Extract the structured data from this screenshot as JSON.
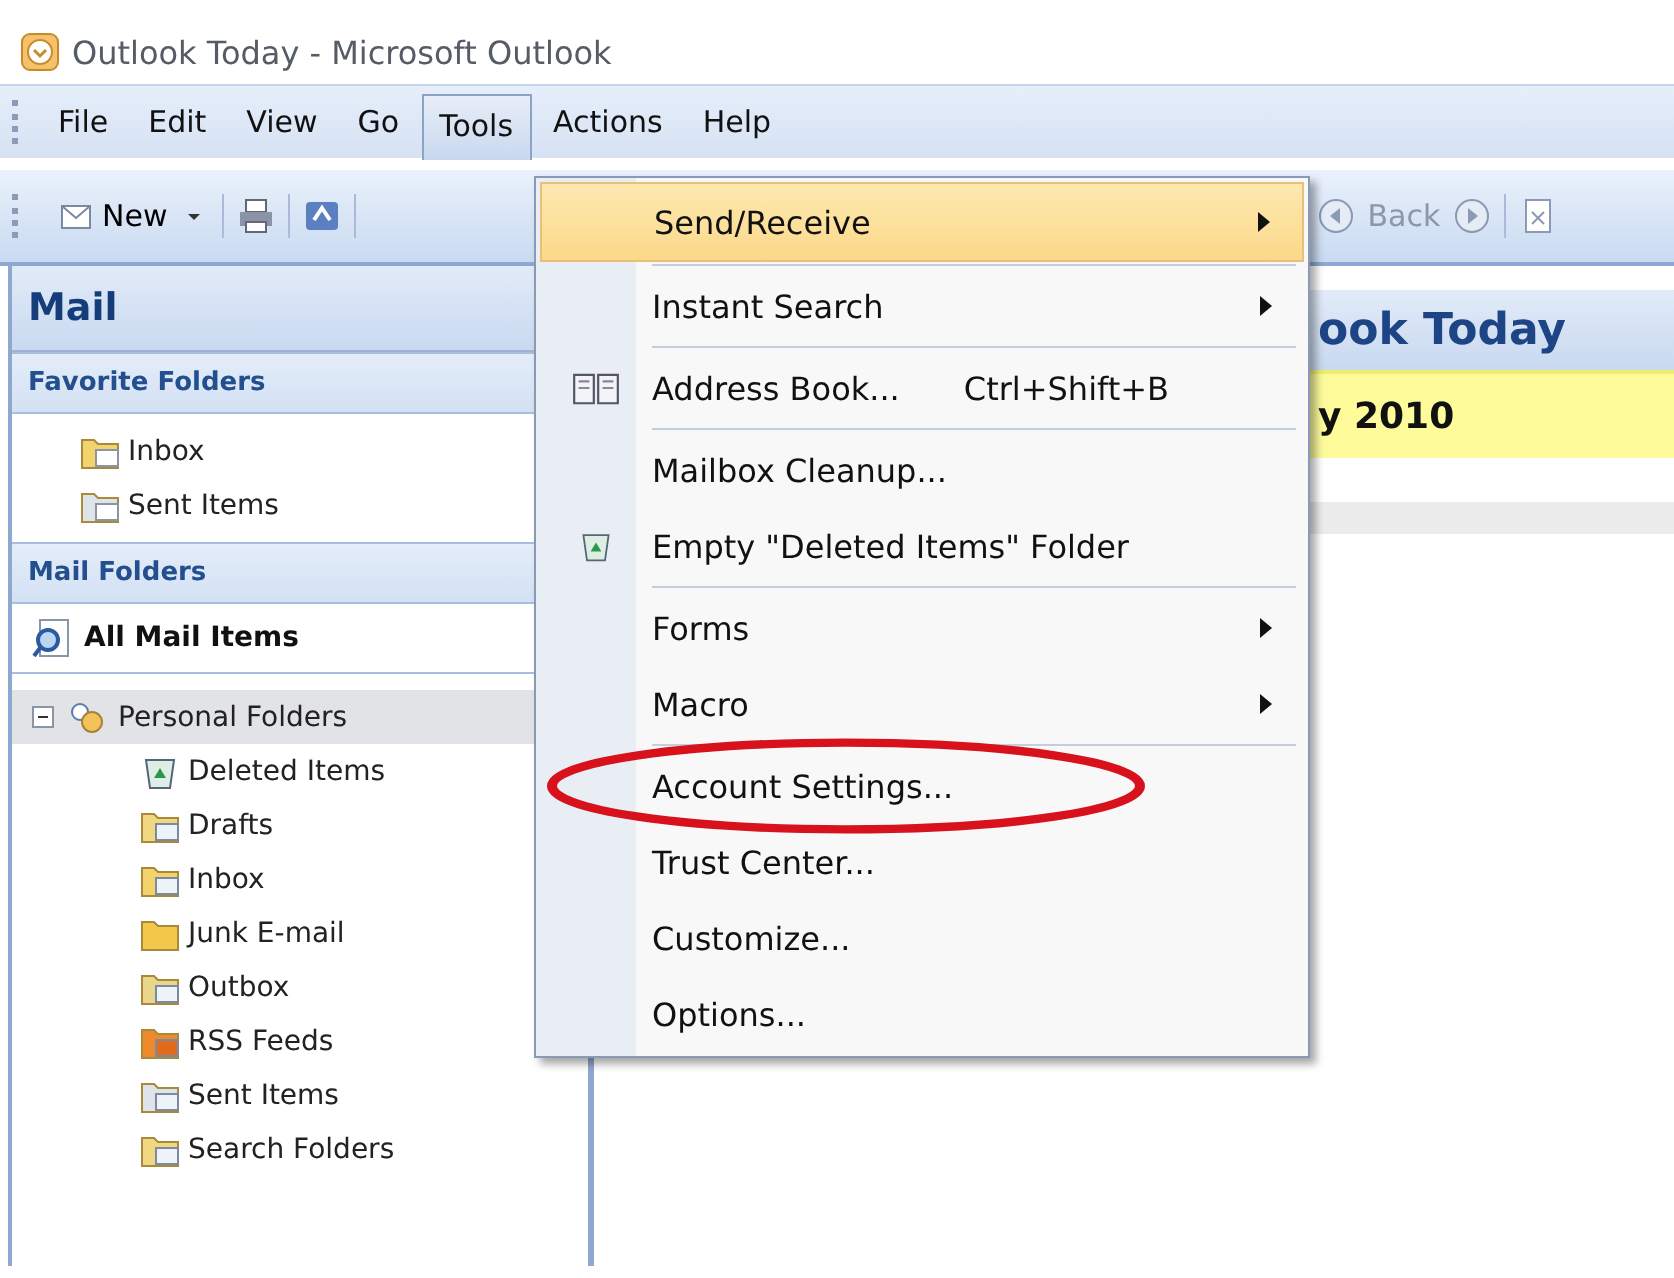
{
  "window": {
    "title": "Outlook Today - Microsoft Outlook"
  },
  "menu_bar": [
    {
      "label": "File",
      "selected": false
    },
    {
      "label": "Edit",
      "selected": false
    },
    {
      "label": "View",
      "selected": false
    },
    {
      "label": "Go",
      "selected": false
    },
    {
      "label": "Tools",
      "selected": true
    },
    {
      "label": "Actions",
      "selected": false
    },
    {
      "label": "Help",
      "selected": false
    }
  ],
  "toolbar": {
    "new_label": "New",
    "back_label": "Back"
  },
  "navigation": {
    "title": "Mail",
    "favorites": {
      "title": "Favorite Folders",
      "items": [
        {
          "label": "Inbox",
          "kind": "inbox"
        },
        {
          "label": "Sent Items",
          "kind": "sent"
        }
      ]
    },
    "mail_folders": {
      "title": "Mail Folders",
      "all_items": "All Mail Items",
      "tree": [
        {
          "label": "Personal Folders",
          "kind": "personal",
          "expanded": true,
          "selected": true,
          "children": [
            {
              "label": "Deleted Items",
              "kind": "trash",
              "selected": false
            },
            {
              "label": "Drafts",
              "kind": "drafts",
              "selected": false
            },
            {
              "label": "Inbox",
              "kind": "inbox",
              "selected": false
            },
            {
              "label": "Junk E-mail",
              "kind": "junk",
              "selected": false
            },
            {
              "label": "Outbox",
              "kind": "outbox",
              "selected": false
            },
            {
              "label": "RSS Feeds",
              "kind": "rss",
              "selected": false
            },
            {
              "label": "Sent Items",
              "kind": "sent",
              "selected": false
            },
            {
              "label": "Search Folders",
              "kind": "search",
              "selected": false
            }
          ]
        }
      ]
    }
  },
  "content": {
    "header": "ook Today",
    "date_banner": "y 2010"
  },
  "tools_menu": [
    {
      "label": "Send/Receive",
      "kind": "plain",
      "submenu": true,
      "selected": true,
      "circled": false,
      "separator_after": true
    },
    {
      "label": "Instant Search",
      "kind": "plain",
      "submenu": true,
      "selected": false,
      "circled": false,
      "separator_after": true
    },
    {
      "label": "Address Book...",
      "kind": "book",
      "shortcut": "Ctrl+Shift+B",
      "submenu": false,
      "selected": false,
      "circled": false,
      "separator_after": true
    },
    {
      "label": "Mailbox Cleanup...",
      "kind": "plain",
      "submenu": false,
      "selected": false,
      "circled": false,
      "separator_after": false
    },
    {
      "label": "Empty \"Deleted Items\" Folder",
      "kind": "bin",
      "submenu": false,
      "selected": false,
      "circled": false,
      "separator_after": true
    },
    {
      "label": "Forms",
      "kind": "plain",
      "submenu": true,
      "selected": false,
      "circled": false,
      "separator_after": false
    },
    {
      "label": "Macro",
      "kind": "plain",
      "submenu": true,
      "selected": false,
      "circled": false,
      "separator_after": true
    },
    {
      "label": "Account Settings...",
      "kind": "plain",
      "submenu": false,
      "selected": false,
      "circled": true,
      "separator_after": false
    },
    {
      "label": "Trust Center...",
      "kind": "plain",
      "submenu": false,
      "selected": false,
      "circled": false,
      "separator_after": false
    },
    {
      "label": "Customize...",
      "kind": "plain",
      "submenu": false,
      "selected": false,
      "circled": false,
      "separator_after": false
    },
    {
      "label": "Options...",
      "kind": "plain",
      "submenu": false,
      "selected": false,
      "circled": false,
      "separator_after": false
    }
  ]
}
